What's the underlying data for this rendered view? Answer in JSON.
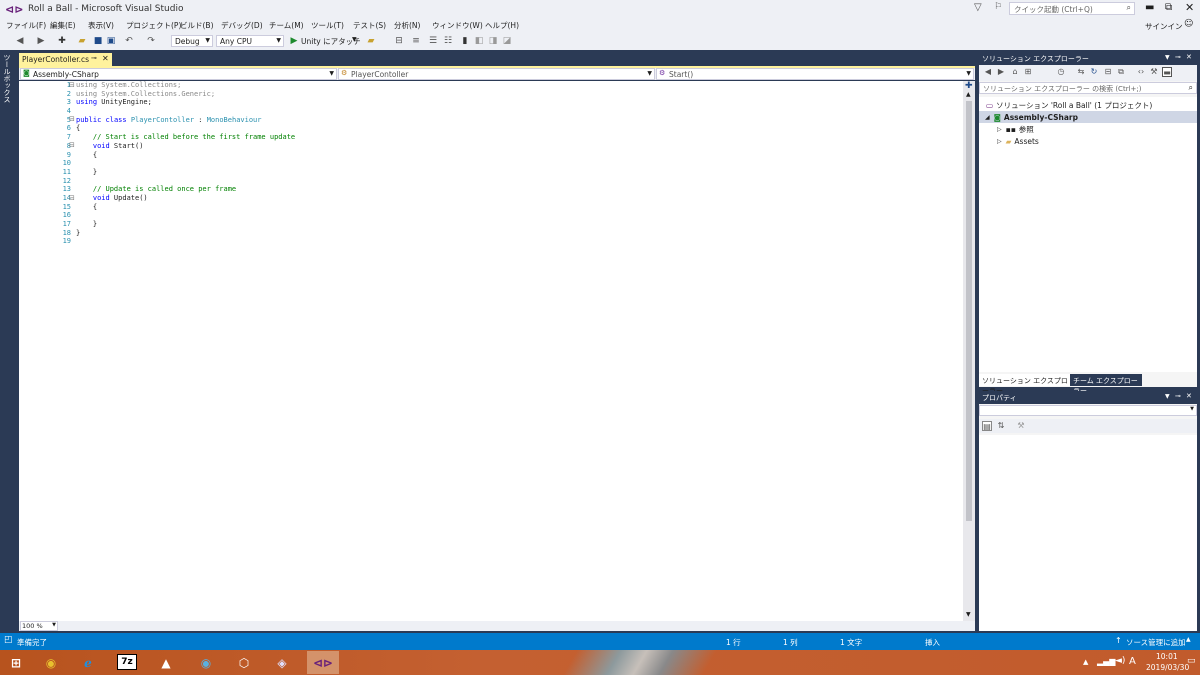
{
  "window": {
    "title": "Roll a Ball - Microsoft Visual Studio",
    "quick_launch_placeholder": "クイック起動 (Ctrl+Q)",
    "signin": "サインイン"
  },
  "menu": [
    "ファイル(F)",
    "編集(E)",
    "表示(V)",
    "プロジェクト(P)",
    "ビルド(B)",
    "デバッグ(D)",
    "チーム(M)",
    "ツール(T)",
    "テスト(S)",
    "分析(N)",
    "ウィンドウ(W)",
    "ヘルプ(H)"
  ],
  "toolbar": {
    "config": "Debug",
    "platform": "Any CPU",
    "attach": "Unity にアタッチ"
  },
  "side_tab": "ツールボックス",
  "editor": {
    "tab_label": "PlayerContoller.cs",
    "nav_project": "Assembly-CSharp",
    "nav_class": "PlayerContoller",
    "nav_member": "Start()",
    "zoom": "100 %",
    "lines": [
      "1",
      "2",
      "3",
      "4",
      "5",
      "6",
      "7",
      "8",
      "9",
      "10",
      "11",
      "12",
      "13",
      "14",
      "15",
      "16",
      "17",
      "18",
      "19"
    ],
    "code": {
      "l1_kw": "using",
      "l1_rest": " System.Collections;",
      "l2_kw": "using",
      "l2_rest": " System.Collections.Generic;",
      "l3_kw": "using",
      "l3_rest": " UnityEngine;",
      "l5_kw1": "public",
      "l5_kw2": " class ",
      "l5_type": "PlayerContoller",
      "l5_colon": " : ",
      "l5_base": "MonoBehaviour",
      "l6": "{",
      "l7": "// Start is called before the first frame update",
      "l8_kw": "void",
      "l8_rest": " Start()",
      "l9": "{",
      "l11": "}",
      "l13": "// Update is called once per frame",
      "l14_kw": "void",
      "l14_rest": " Update()",
      "l15": "{",
      "l17": "}",
      "l18": "}"
    }
  },
  "solution_explorer": {
    "title": "ソリューション エクスプローラー",
    "search_placeholder": "ソリューション エクスプローラー の検索 (Ctrl+;)",
    "solution": "ソリューション 'Roll a Ball' (1 プロジェクト)",
    "project": "Assembly-CSharp",
    "refs": "参照",
    "assets": "Assets",
    "tab1": "ソリューション エクスプローラー",
    "tab2": "チーム エクスプローラー"
  },
  "properties": {
    "title": "プロパティ"
  },
  "status": {
    "ready": "準備完了",
    "row": "1 行",
    "col": "1 列",
    "ch": "1 文字",
    "mode": "挿入",
    "source_control": "ソース管理に追加"
  },
  "taskbar": {
    "time": "10:01",
    "date": "2019/03/30",
    "ime": "A",
    "seven_zip": "7z"
  },
  "colors": {
    "accent": "#007acc",
    "tab_active": "#fff29d",
    "frame": "#2b3a55"
  }
}
